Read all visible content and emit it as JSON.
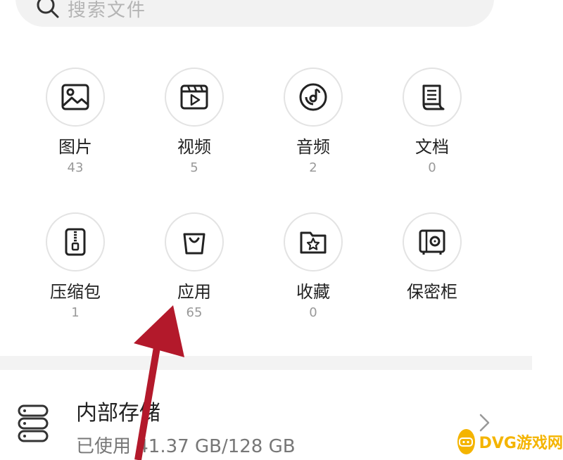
{
  "search": {
    "placeholder": "搜索文件"
  },
  "categories": [
    {
      "label": "图片",
      "count": "43",
      "icon": "image-icon"
    },
    {
      "label": "视频",
      "count": "5",
      "icon": "video-icon"
    },
    {
      "label": "音频",
      "count": "2",
      "icon": "audio-icon"
    },
    {
      "label": "文档",
      "count": "0",
      "icon": "document-icon"
    },
    {
      "label": "压缩包",
      "count": "1",
      "icon": "archive-icon"
    },
    {
      "label": "应用",
      "count": "65",
      "icon": "shopping-bag-icon"
    },
    {
      "label": "收藏",
      "count": "0",
      "icon": "favorites-folder-icon"
    },
    {
      "label": "保密柜",
      "count": "",
      "icon": "safe-icon"
    }
  ],
  "storage": {
    "title": "内部存储",
    "usage": "已使用 41.37 GB/128 GB"
  },
  "annotation": {
    "arrow_color": "#b3192b"
  },
  "watermark": {
    "text": "DVG游戏网"
  }
}
